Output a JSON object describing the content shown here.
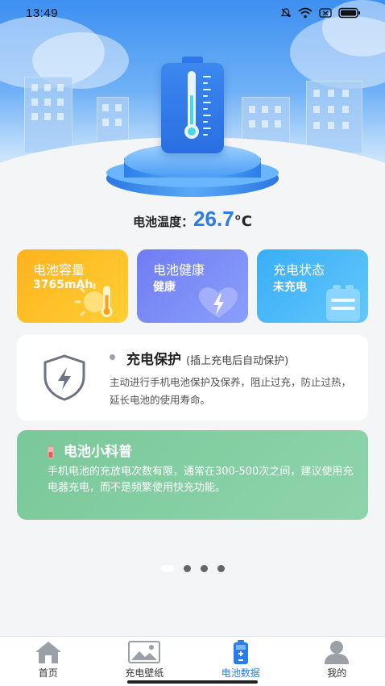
{
  "status_bar": {
    "time": "13:49",
    "icons": [
      "mute-icon",
      "wifi-icon",
      "sim-icon",
      "battery-icon"
    ]
  },
  "temperature": {
    "label": "电池温度：",
    "value": "26.7",
    "unit": "°C"
  },
  "cards": [
    {
      "title": "电池容量",
      "value": "3765mAh",
      "icon": "thermometer-sun-icon",
      "color": "#ffbb22"
    },
    {
      "title": "电池健康",
      "value": "健康",
      "icon": "heart-bolt-icon",
      "color": "#7886f5"
    },
    {
      "title": "充电状态",
      "value": "未充电",
      "icon": "battery-clipboard-icon",
      "color": "#45b5f8"
    }
  ],
  "protection": {
    "title": "充电保护",
    "subtitle": "(插上充电后自动保护)",
    "description": "主动进行手机电池保护及保养，阻止过充，防止过热，延长电池的使用寿命。",
    "icon": "shield-bolt-icon"
  },
  "tip": {
    "title": "电池小科普",
    "text": "手机电池的充放电次数有限，通常在300-500次之间，建议使用充电器充电，而不是频繁使用快充功能。",
    "icon": "small-battery-icon"
  },
  "pager": {
    "total": 4,
    "active": 0
  },
  "tabs": [
    {
      "label": "首页",
      "icon": "home-icon",
      "active": false
    },
    {
      "label": "充电壁纸",
      "icon": "image-icon",
      "active": false
    },
    {
      "label": "电池数据",
      "icon": "battery-icon",
      "active": true
    },
    {
      "label": "我的",
      "icon": "user-icon",
      "active": false
    }
  ],
  "colors": {
    "accent": "#2a7de6",
    "tip_green": "#82cca2"
  }
}
